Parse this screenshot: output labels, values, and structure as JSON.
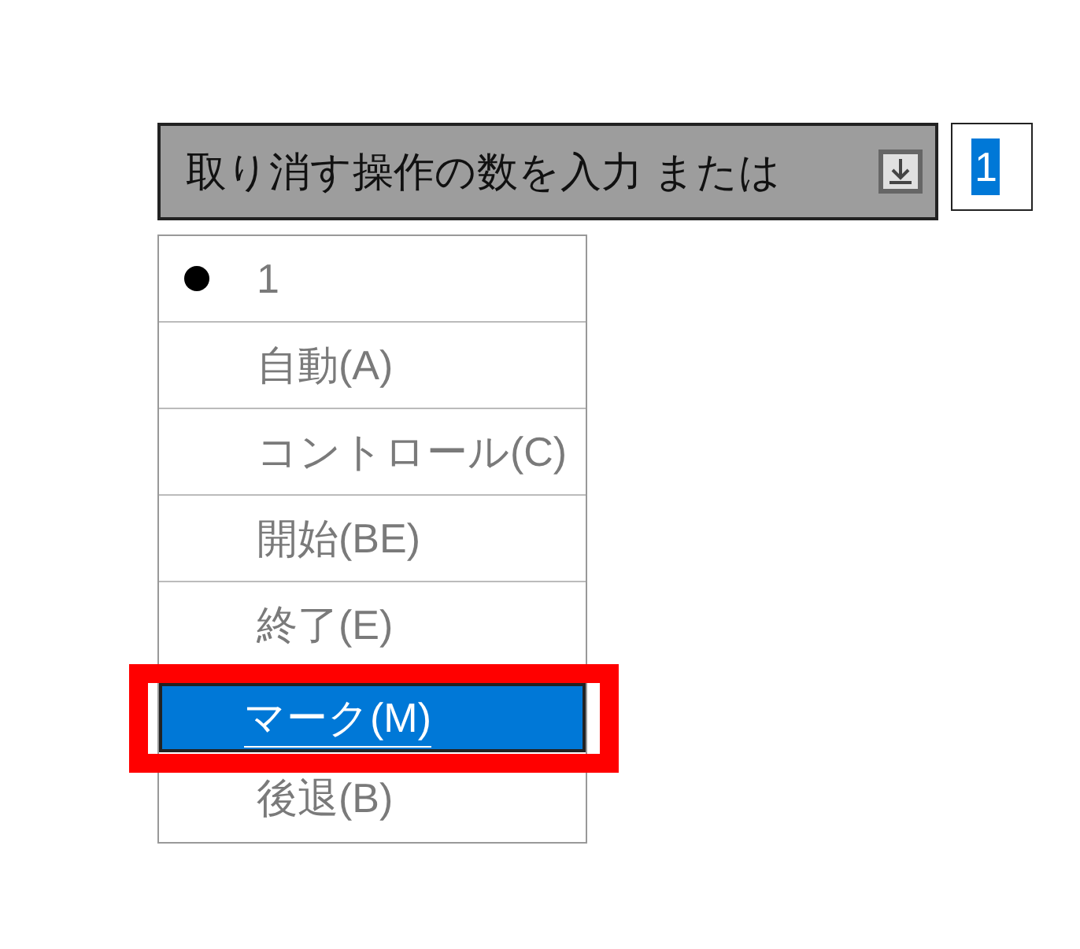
{
  "combo": {
    "label": "取り消す操作の数を入力 または",
    "value": "1"
  },
  "items": [
    {
      "label": "1",
      "current": true,
      "selected": false,
      "annotated": false
    },
    {
      "label": "自動(A)",
      "current": false,
      "selected": false,
      "annotated": false
    },
    {
      "label": "コントロール(C)",
      "current": false,
      "selected": false,
      "annotated": false
    },
    {
      "label": "開始(BE)",
      "current": false,
      "selected": false,
      "annotated": false
    },
    {
      "label": "終了(E)",
      "current": false,
      "selected": false,
      "annotated": false
    },
    {
      "label": "マーク(M)",
      "current": false,
      "selected": true,
      "annotated": true
    },
    {
      "label": "後退(B)",
      "current": false,
      "selected": false,
      "annotated": false
    }
  ]
}
